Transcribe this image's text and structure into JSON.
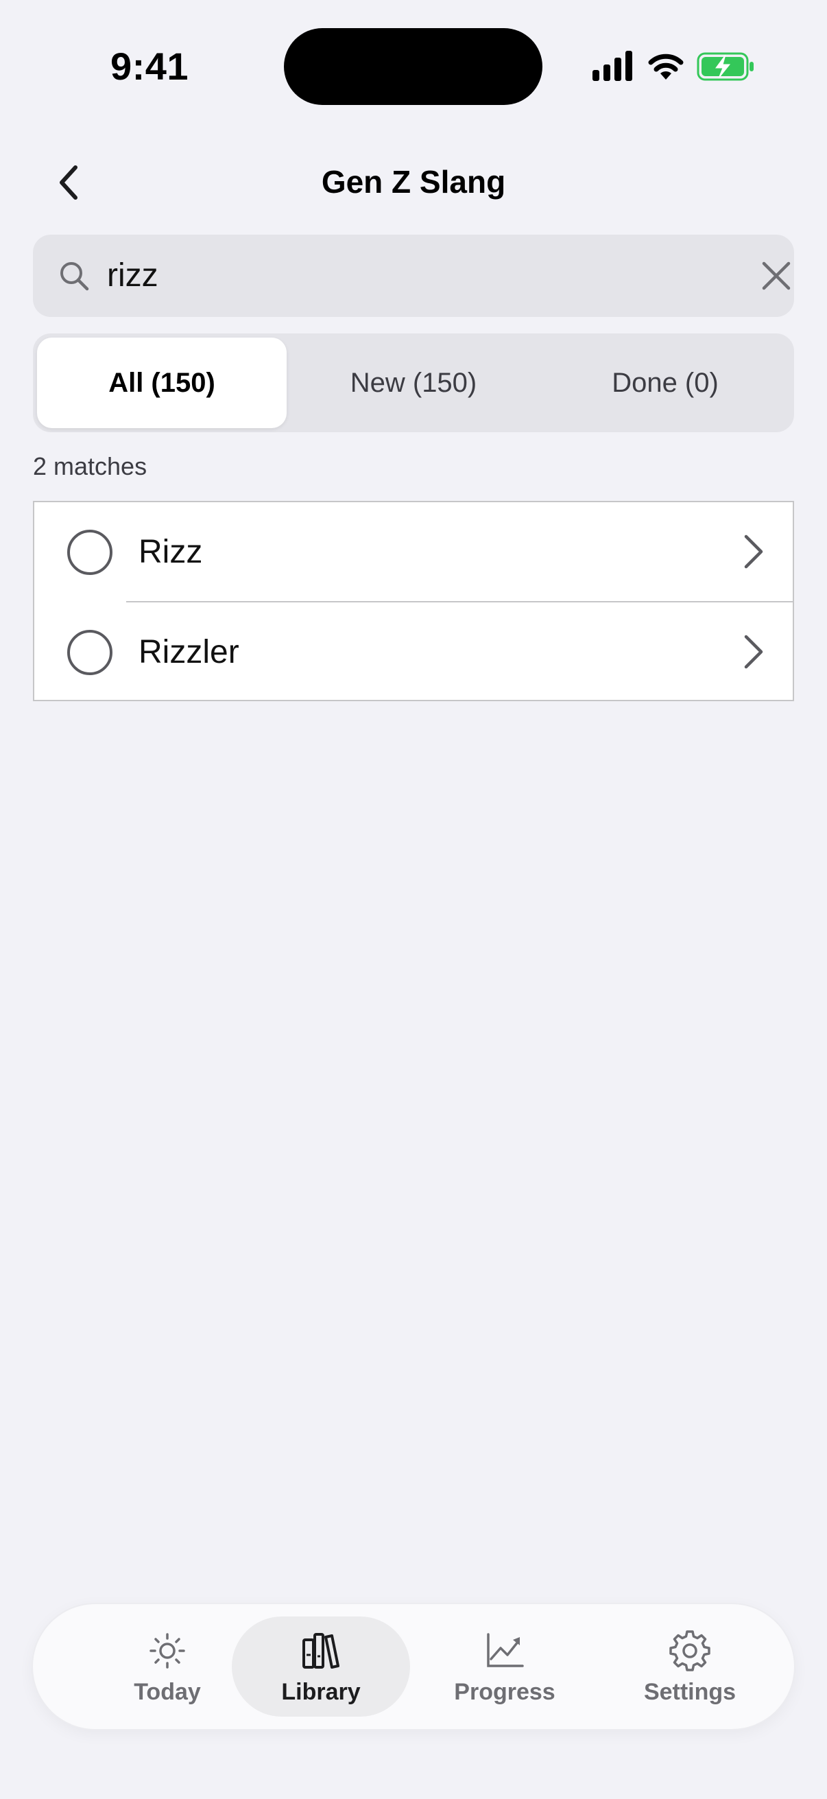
{
  "status_bar": {
    "time": "9:41",
    "battery_color": "#34c759"
  },
  "header": {
    "title": "Gen Z Slang"
  },
  "search": {
    "value": "rizz"
  },
  "segments": [
    {
      "label": "All (150)",
      "selected": true
    },
    {
      "label": "New (150)",
      "selected": false
    },
    {
      "label": "Done (0)",
      "selected": false
    }
  ],
  "results": {
    "count_text": "2 matches",
    "items": [
      {
        "label": "Rizz",
        "checked": false
      },
      {
        "label": "Rizzler",
        "checked": false
      }
    ]
  },
  "tab_bar": {
    "tabs": [
      {
        "label": "Today",
        "icon": "sun-icon",
        "selected": false
      },
      {
        "label": "Library",
        "icon": "books-icon",
        "selected": true
      },
      {
        "label": "Progress",
        "icon": "chart-icon",
        "selected": false
      },
      {
        "label": "Settings",
        "icon": "gear-icon",
        "selected": false
      }
    ]
  }
}
